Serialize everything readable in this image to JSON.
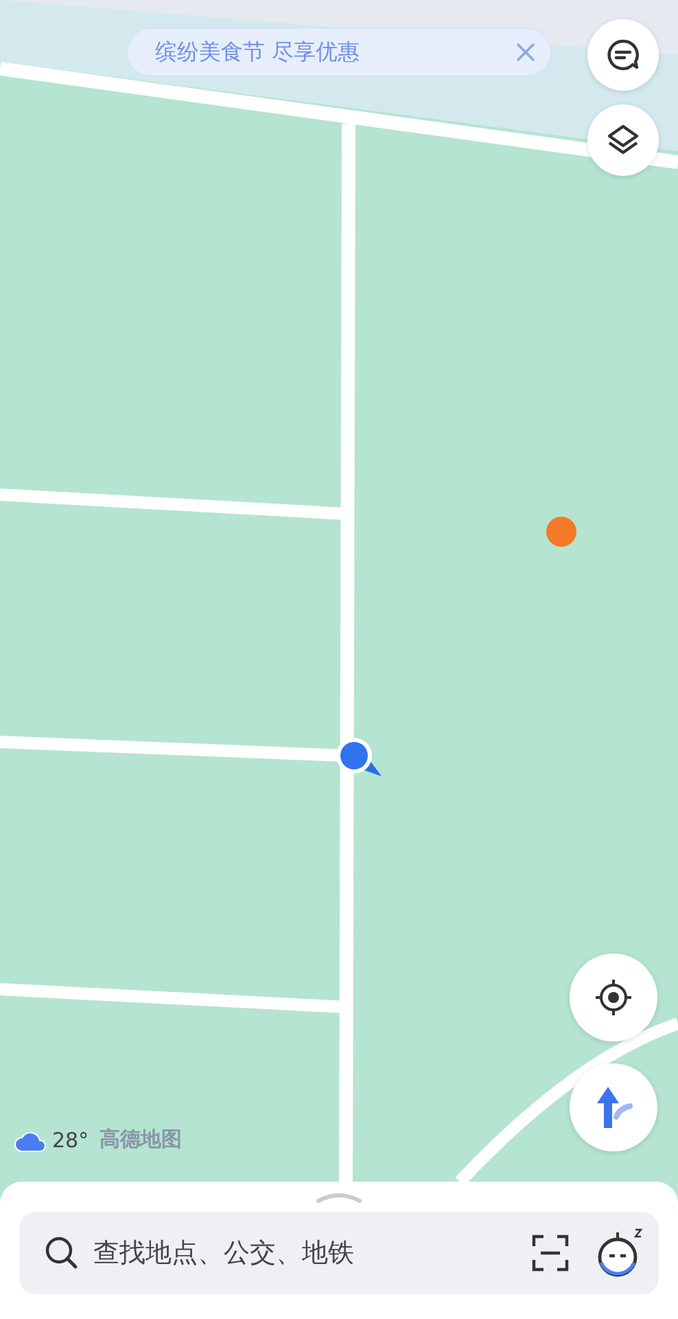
{
  "banner": {
    "text": "缤纷美食节 尽享优惠"
  },
  "weather": {
    "temperature": "28°",
    "brand": "高德地图"
  },
  "search": {
    "placeholder": "查找地点、公交、地铁"
  }
}
